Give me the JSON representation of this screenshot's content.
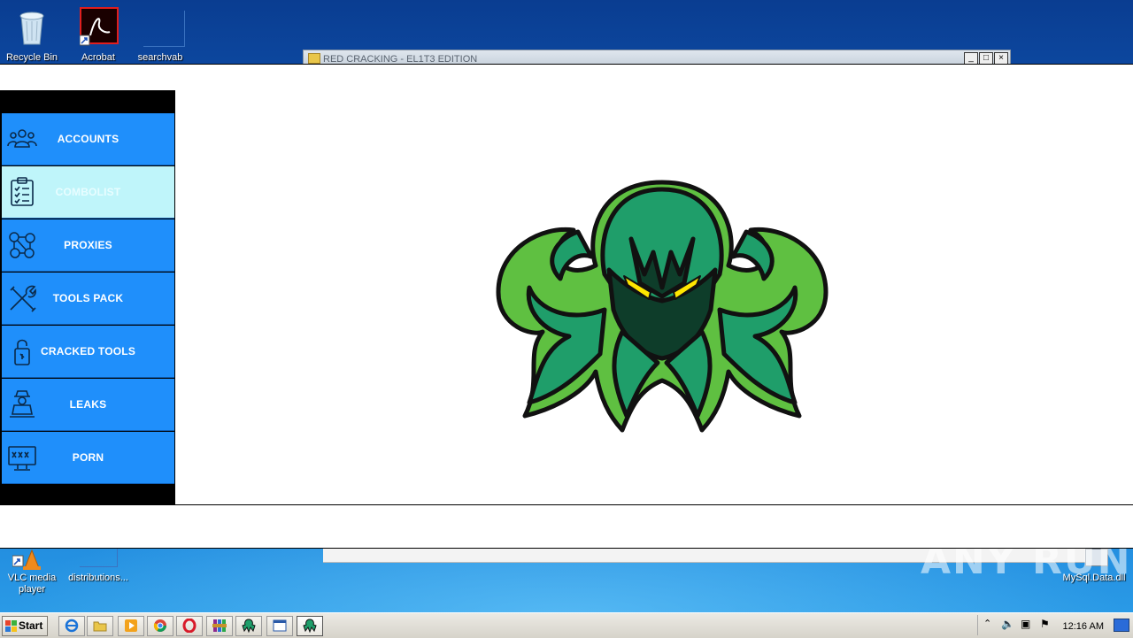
{
  "desktop": {
    "icons_top": [
      {
        "label": "Recycle Bin"
      },
      {
        "label": "Acrobat"
      },
      {
        "label": "searchvab"
      }
    ],
    "icons_bottom": [
      {
        "label_line1": "VLC media",
        "label_line2": "player"
      },
      {
        "label_line1": "distributions...",
        "label_line2": ""
      },
      {
        "label_line1": "MySql.Data.dll",
        "label_line2": ""
      }
    ],
    "watermark": "ANY RUN"
  },
  "background_window": {
    "title": "RED CRACKING - EL1T3 EDITION"
  },
  "app": {
    "nav": [
      {
        "label": "ACCOUNTS",
        "icon": "people-group-icon"
      },
      {
        "label": "COMBOLIST",
        "icon": "clipboard-checklist-icon",
        "active": true
      },
      {
        "label": "PROXIES",
        "icon": "network-nodes-icon"
      },
      {
        "label": "TOOLS PACK",
        "icon": "wrench-screwdriver-icon"
      },
      {
        "label": "CRACKED TOOLS",
        "icon": "padlock-icon"
      },
      {
        "label": "LEAKS",
        "icon": "hacker-laptop-icon"
      },
      {
        "label": "PORN",
        "icon": "xxx-monitor-icon"
      }
    ],
    "logo": "kraken-mascot-logo",
    "colors": {
      "nav_bg": "#1f8ffb",
      "nav_active_bg": "#bff5fa",
      "logo_green": "#1f9e6a",
      "logo_outline": "#7bd44a",
      "logo_eyes": "#ffe600"
    }
  },
  "taskbar": {
    "start_label": "Start",
    "clock": "12:16 AM"
  }
}
